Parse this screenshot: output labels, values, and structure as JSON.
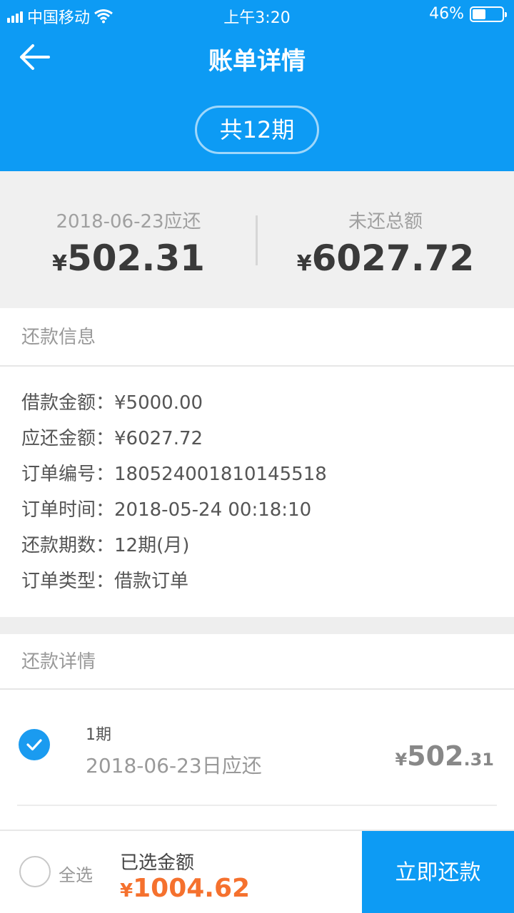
{
  "status_bar": {
    "carrier": "中国移动",
    "time": "上午3:20",
    "battery": "46%",
    "battery_level": 0.46
  },
  "nav": {
    "title": "账单详情",
    "periods_badge": "共12期"
  },
  "summary": {
    "due": {
      "label": "2018-06-23应还",
      "currency": "¥",
      "amount": "502.31"
    },
    "outstanding": {
      "label": "未还总额",
      "currency": "¥",
      "amount": "6027.72"
    }
  },
  "repay_info": {
    "title": "还款信息",
    "rows": [
      {
        "label": "借款金额：",
        "value": "¥5000.00"
      },
      {
        "label": "应还金额：",
        "value": "¥6027.72"
      },
      {
        "label": "订单编号：",
        "value": "180524001810145518"
      },
      {
        "label": "订单时间：",
        "value": "2018-05-24 00:18:10"
      },
      {
        "label": "还款期数：",
        "value": "12期(月)"
      },
      {
        "label": "订单类型：",
        "value": "借款订单"
      }
    ]
  },
  "repay_details": {
    "title": "还款详情",
    "items": [
      {
        "period": "1期",
        "date": "2018-06-23日应还",
        "currency": "¥",
        "amount_int": "502",
        "amount_dec": ".31",
        "checked": true
      }
    ]
  },
  "footer": {
    "select_all": "全选",
    "selected_label": "已选金额",
    "currency": "¥",
    "selected_amount": "1004.62",
    "pay_button": "立即还款"
  },
  "colors": {
    "primary": "#0d9bf4",
    "accent": "#f5712e",
    "summary_bg": "#f0f0f0"
  },
  "icons": {
    "back": "arrow-left-icon",
    "check": "checkmark-icon",
    "wifi": "wifi-icon",
    "signal": "signal-icon",
    "battery": "battery-icon"
  }
}
